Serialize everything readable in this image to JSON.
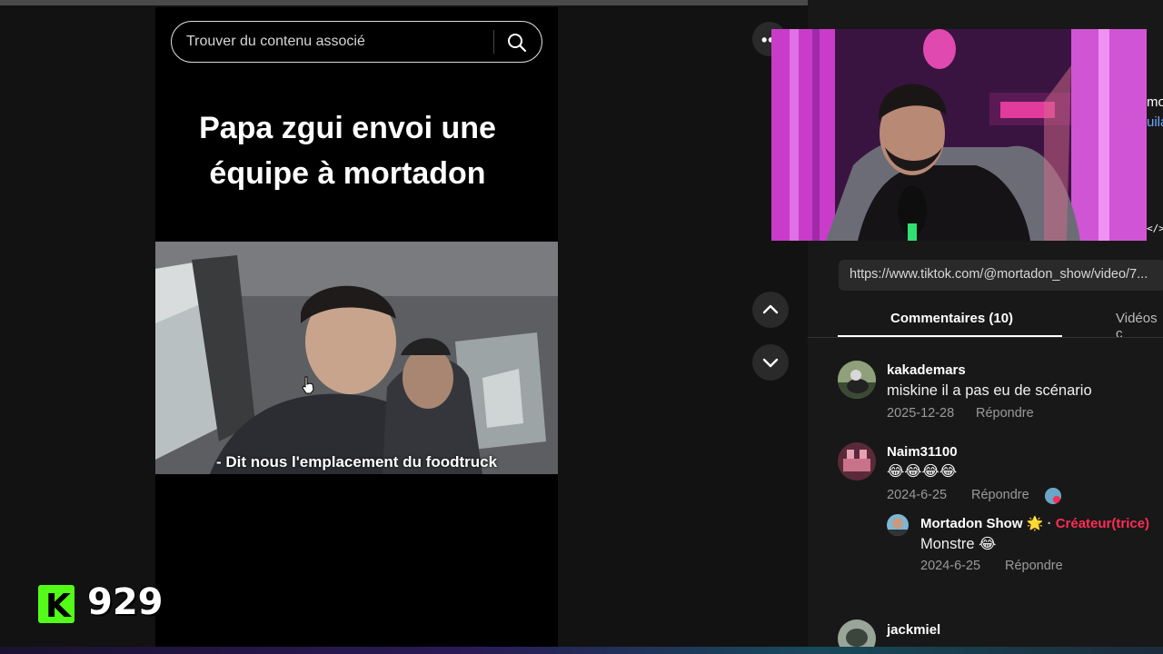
{
  "search": {
    "placeholder": "Trouver du contenu associé"
  },
  "video": {
    "caption_line1": "Papa zgui envoi une",
    "caption_line2": "équipe à mortadon",
    "subtitle": "- Dit nous l'emplacement du foodtruck"
  },
  "overlay": {
    "viewer_count": "929",
    "kick_letter": "K"
  },
  "side": {
    "peek_line1": "mo",
    "peek_line2": "uila",
    "embed_label": "</>",
    "more_label": "•••",
    "url": "https://www.tiktok.com/@mortadon_show/video/7..."
  },
  "tabs": {
    "comments": "Commentaires (10)",
    "videos": "Vidéos c"
  },
  "comments": [
    {
      "user": "kakademars",
      "text": "miskine il a pas eu de scénario",
      "date": "2025-12-28",
      "reply": "Répondre"
    },
    {
      "user": "Naim31100",
      "text": "😂😂😂😂",
      "date": "2024-6-25",
      "reply": "Répondre",
      "sub": {
        "user": "Mortadon Show 🌟",
        "sep": "·",
        "badge": "Créateur(trice)",
        "text": "Monstre 😂",
        "date": "2024-6-25",
        "reply": "Répondre"
      }
    },
    {
      "user": "jackmiel"
    }
  ],
  "colors": {
    "kick_green": "#53fc18",
    "creator_red": "#fe2c55"
  }
}
